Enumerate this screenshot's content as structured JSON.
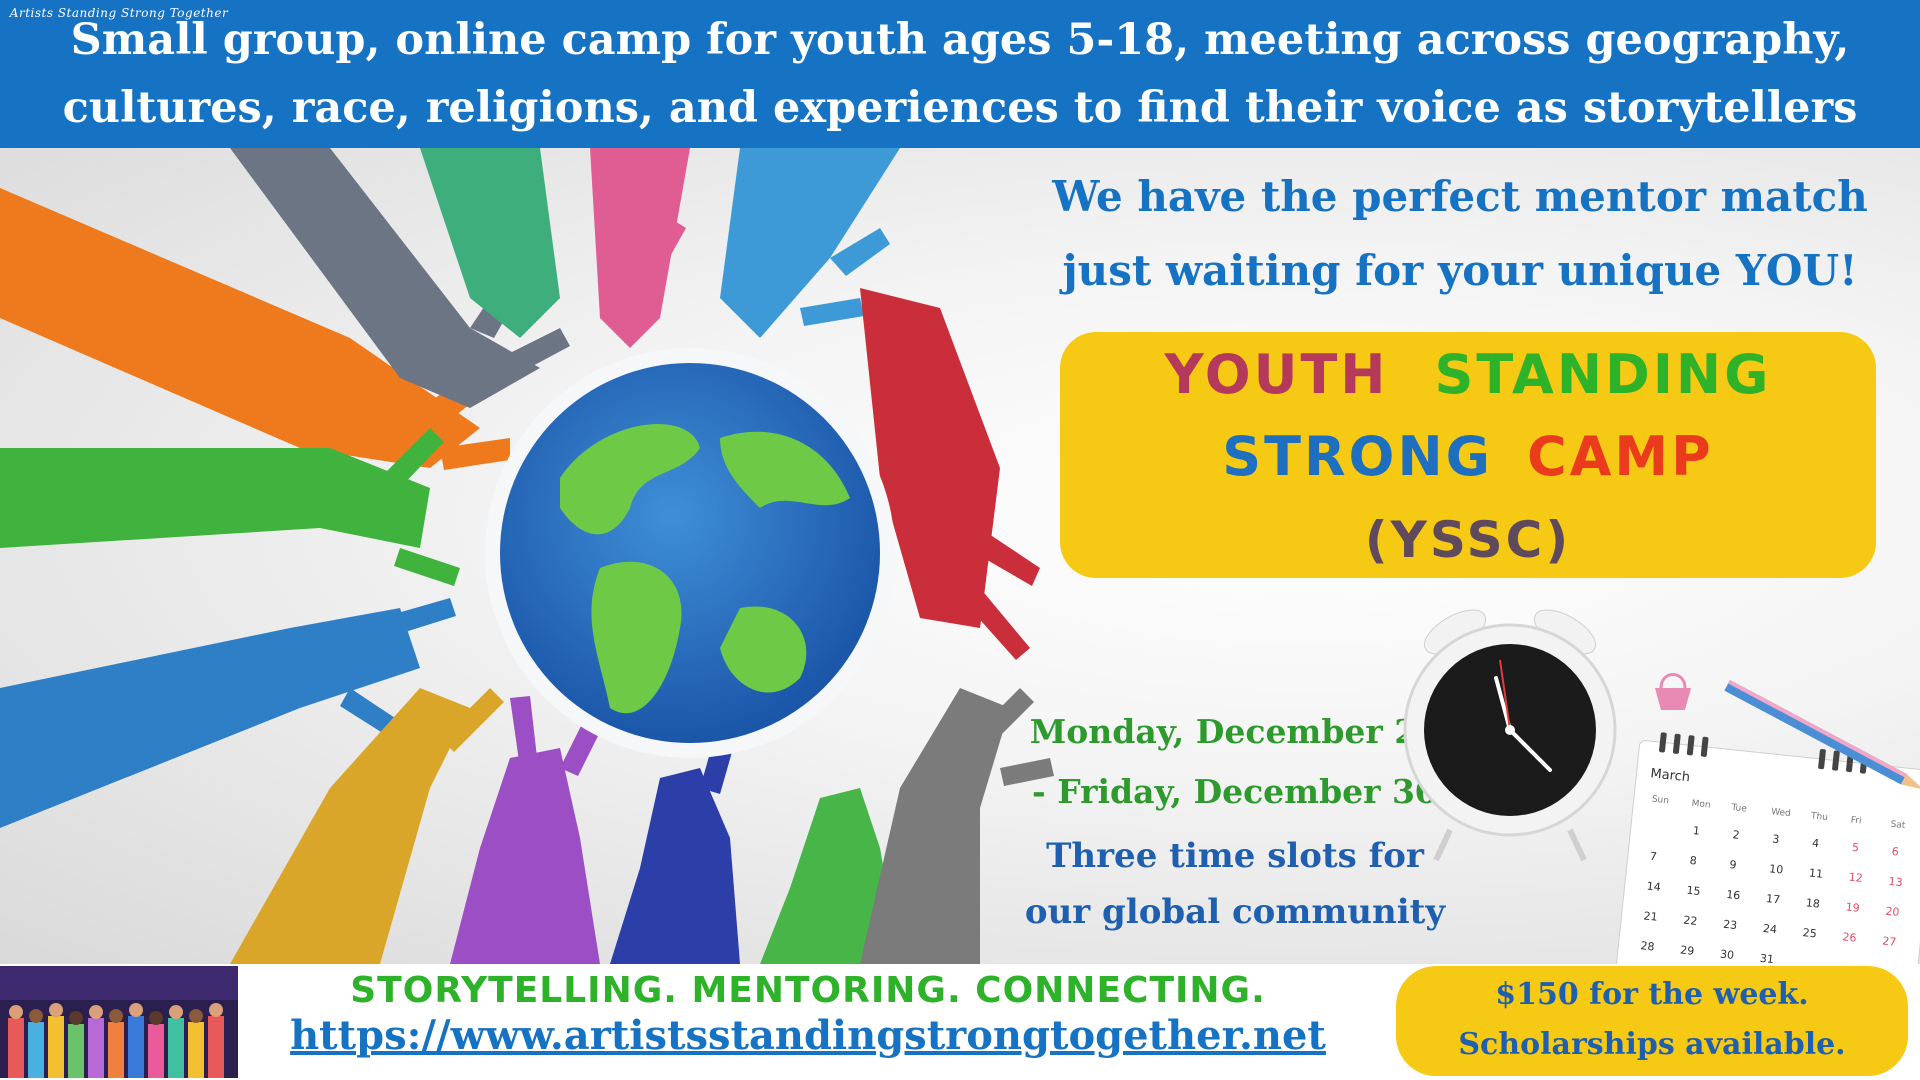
{
  "banner": {
    "line1": "Small group, online camp for youth  ages 5-18, meeting across geography,",
    "line2": "cultures, race, religions, and experiences to find their voice as storytellers"
  },
  "tagline": {
    "line1": "We have the perfect mentor match",
    "line2": "just waiting for your unique YOU!"
  },
  "camp_title": {
    "word1": "YOUTH",
    "word2": "STANDING",
    "word3": "STRONG",
    "word4": "CAMP",
    "acronym": "(YSSC)"
  },
  "dates": {
    "line1": "Monday, December 26",
    "line2": "- Friday, December 30"
  },
  "slots": {
    "line1": "Three time slots for",
    "line2": "our global community"
  },
  "calendar": {
    "month": "March",
    "days": [
      "Sun",
      "Mon",
      "Tue",
      "Wed",
      "Thu",
      "Fri",
      "Sat"
    ],
    "rows": [
      [
        "",
        "1",
        "2",
        "3",
        "4",
        "5",
        "6"
      ],
      [
        "7",
        "8",
        "9",
        "10",
        "11",
        "12",
        "13"
      ],
      [
        "14",
        "15",
        "16",
        "17",
        "18",
        "19",
        "20"
      ],
      [
        "21",
        "22",
        "23",
        "24",
        "25",
        "26",
        "27"
      ],
      [
        "28",
        "29",
        "30",
        "31",
        "",
        "",
        ""
      ]
    ]
  },
  "footer": {
    "logo_text": "Artists Standing Strong Together",
    "slogan": "STORYTELLING. MENTORING. CONNECTING.",
    "url": "https://www.artistsstandingstrongtogether.net"
  },
  "price": {
    "line1": "$150 for the week.",
    "line2": "Scholarships available."
  },
  "colors": {
    "banner_blue": "#1672c2",
    "accent_yellow": "#f6c915",
    "youth": "#b5395b",
    "standing": "#2db22a",
    "strong": "#1e6fc0",
    "camp": "#ea3c1c",
    "date_green": "#2e9a2e"
  }
}
